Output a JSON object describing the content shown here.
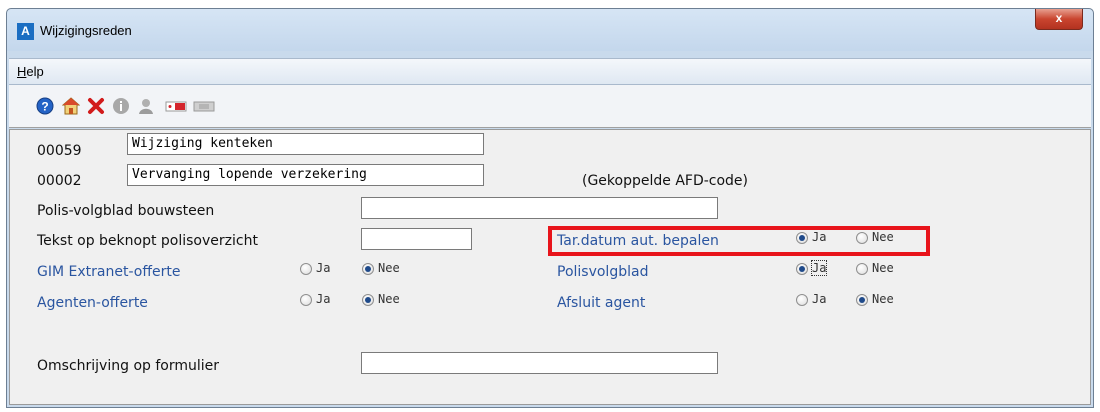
{
  "window": {
    "title": "Wijzigingsreden",
    "app_icon_letter": "A",
    "close_glyph": "x"
  },
  "menu": {
    "help_first": "H",
    "help_rest": "elp"
  },
  "toolbar": {
    "icons": [
      "help-icon",
      "home-icon",
      "delete-icon",
      "info-icon",
      "person-icon",
      "card-red-icon",
      "card-gray-icon"
    ]
  },
  "form": {
    "row1": {
      "code": "00059",
      "value": "Wijziging kenteken"
    },
    "row2": {
      "code": "00002",
      "value": "Vervanging lopende verzekering",
      "note": "(Gekoppelde AFD-code)"
    },
    "polis_volgblad_bouwsteen": {
      "label": "Polis-volgblad bouwsteen",
      "value": ""
    },
    "tekst_beknopt": {
      "label": "Tekst op beknopt polisoverzicht",
      "value": ""
    },
    "gim_extranet": {
      "label": "GIM Extranet-offerte",
      "ja": "Ja",
      "nee": "Nee",
      "selected": "Nee"
    },
    "agenten_offerte": {
      "label": "Agenten-offerte",
      "ja": "Ja",
      "nee": "Nee",
      "selected": "Nee"
    },
    "tar_datum": {
      "label": "Tar.datum aut. bepalen",
      "ja": "Ja",
      "nee": "Nee",
      "selected": "Ja"
    },
    "polisvolgblad": {
      "label": "Polisvolgblad",
      "ja": "Ja",
      "nee": "Nee",
      "selected": "Ja"
    },
    "afsluit_agent": {
      "label": "Afsluit agent",
      "ja": "Ja",
      "nee": "Nee",
      "selected": "Nee"
    },
    "omschrijving": {
      "label": "Omschrijving op formulier",
      "value": ""
    }
  },
  "colors": {
    "highlight": "#e8141b",
    "field_label_blue": "#2a55a0"
  }
}
